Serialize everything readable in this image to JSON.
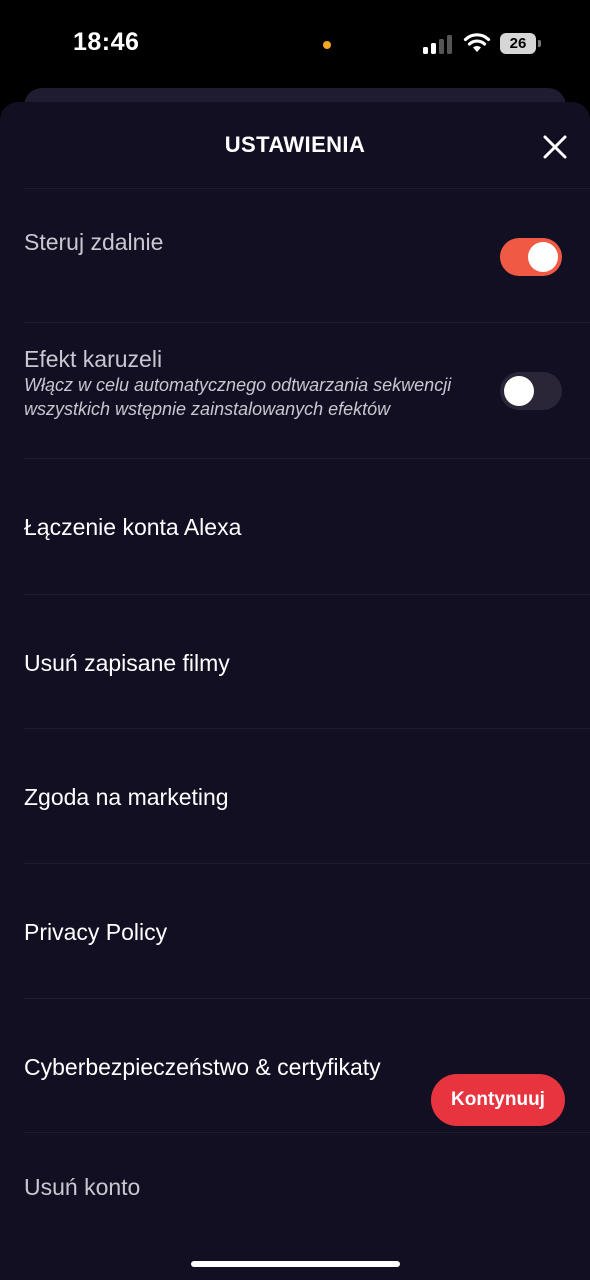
{
  "status_bar": {
    "time": "18:46",
    "battery": "26",
    "icons": [
      "signal-icon",
      "wifi-icon",
      "battery-icon"
    ]
  },
  "header": {
    "title": "USTAWIENIA",
    "close_icon": "close-icon"
  },
  "settings": {
    "remote": {
      "label": "Steruj zdalnie",
      "enabled": true
    },
    "carousel": {
      "label": "Efekt karuzeli",
      "description": "Włącz w celu automatycznego odtwarzania sekwencji wszystkich wstępnie zainstalowanych efektów",
      "enabled": false
    },
    "alexa": "Łączenie konta Alexa",
    "delete_movies": "Usuń zapisane filmy",
    "marketing": "Zgoda na marketing",
    "privacy": "Privacy Policy",
    "cyber": "Cyberbezpieczeństwo & certyfikaty",
    "delete_account": "Usuń konto"
  },
  "continue_button": "Kontynuuj",
  "colors": {
    "sheet_bg": "#130f23",
    "toggle_on": "#f05a44",
    "toggle_off": "#2a2638",
    "button_red": "#e8343f"
  }
}
